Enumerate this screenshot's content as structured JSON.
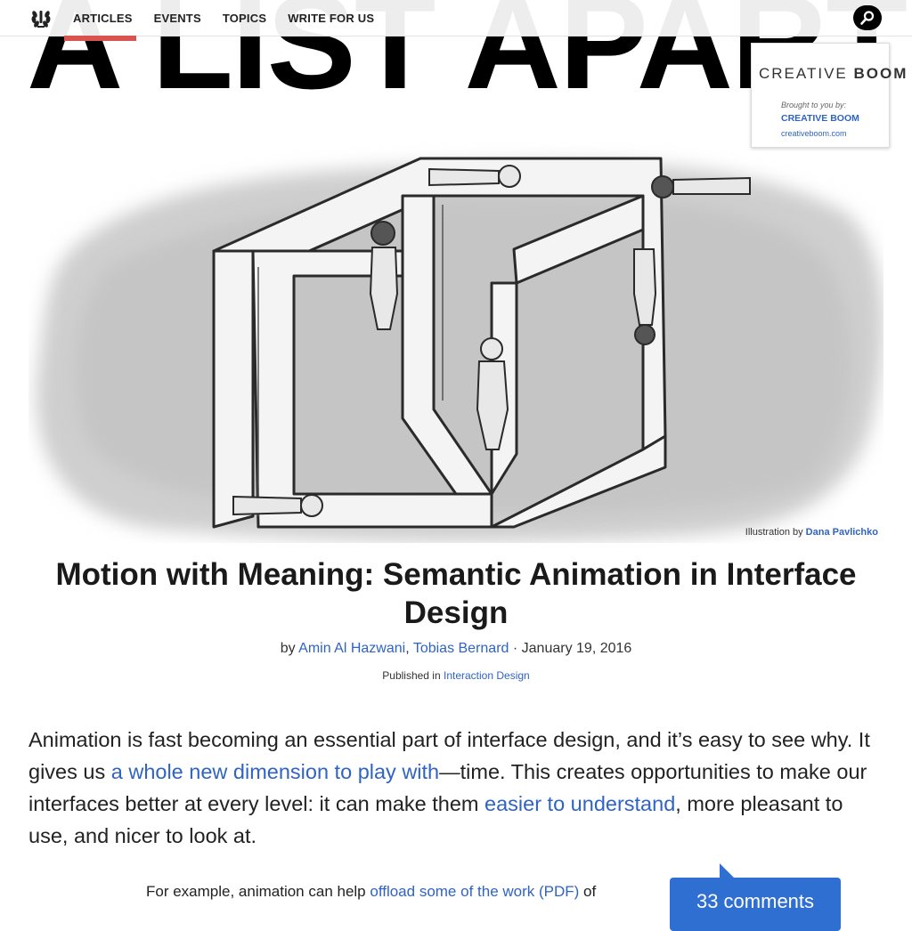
{
  "site": {
    "masthead": "A LIST APART"
  },
  "nav": {
    "items": [
      "ARTICLES",
      "EVENTS",
      "TOPICS",
      "WRITE FOR US"
    ],
    "search_icon": "search-icon",
    "logo_icon": "laurel-logo-icon"
  },
  "sponsor": {
    "logo_light": "CREATIVE ",
    "logo_bold": "BOOM",
    "brought": "Brought to you by:",
    "name": "CREATIVE BOOM",
    "url": "creativeboom.com"
  },
  "hero": {
    "credit_prefix": "Illustration by",
    "credit_name": "Dana Pavlichko"
  },
  "article": {
    "title": "Motion with Meaning: Semantic Animation in Interface Design",
    "by": "by",
    "author1": "Amin Al Hazwani",
    "sep": ",",
    "author2": "Tobias Bernard",
    "date": " · January 19, 2016",
    "published_prefix": "Published in",
    "category": "Interaction Design",
    "lead_1": "Animation is fast becoming an essential part of interface design, and it’s easy to see why. It gives us ",
    "lead_link1": "a whole new dimension to play with",
    "lead_2": "—time. This creates opportunities to make our interfaces better at every level: it can make them ",
    "lead_link2": "easier to understand",
    "lead_3": ", more pleasant to use, and nicer to look at.",
    "body_1": "For example, animation can help ",
    "body_link": "offload some of the work (PDF)",
    "body_2": " of"
  },
  "comments": {
    "label": "33 comments"
  },
  "colors": {
    "link": "#2f63c4",
    "accent_red": "#d9534f",
    "comments_blue": "#2f6fd1"
  }
}
